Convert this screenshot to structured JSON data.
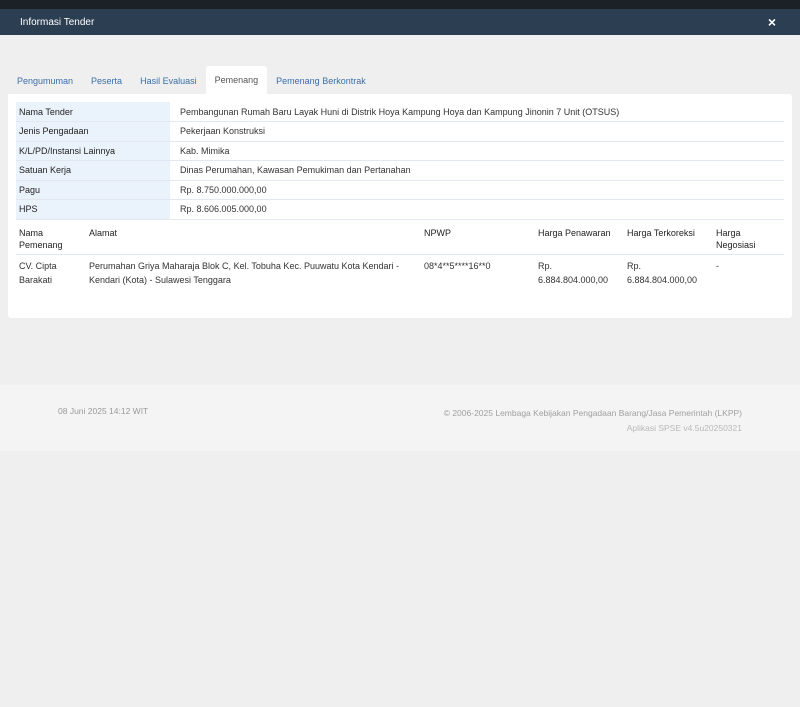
{
  "modal": {
    "title": "Informasi Tender",
    "close_icon": "×"
  },
  "tabs": [
    "Pengumuman",
    "Peserta",
    "Hasil Evaluasi",
    "Pemenang",
    "Pemenang Berkontrak"
  ],
  "active_tab": "Pemenang",
  "info": [
    {
      "label": "Nama Tender",
      "value": "Pembangunan Rumah Baru Layak Huni di Distrik Hoya Kampung Hoya dan Kampung Jinonin 7 Unit (OTSUS)"
    },
    {
      "label": "Jenis Pengadaan",
      "value": "Pekerjaan Konstruksi"
    },
    {
      "label": "K/L/PD/Instansi Lainnya",
      "value": "Kab. Mimika"
    },
    {
      "label": "Satuan Kerja",
      "value": "Dinas Perumahan, Kawasan Pemukiman dan Pertanahan"
    },
    {
      "label": "Pagu",
      "value": "Rp. 8.750.000.000,00"
    },
    {
      "label": "HPS",
      "value": "Rp. 8.606.005.000,00"
    }
  ],
  "winners": {
    "headers": {
      "nama_a": "Nama",
      "nama_b": "Pemenang",
      "alamat": "Alamat",
      "npwp": "NPWP",
      "harga_penawaran": "Harga Penawaran",
      "harga_terkoreksi": "Harga Terkoreksi",
      "negosiasi_a": "Harga",
      "negosiasi_b": "Negosiasi"
    },
    "rows": [
      {
        "nama_a": "CV. Cipta",
        "nama_b": "Barakati",
        "alamat_a": "Perumahan Griya Maharaja Blok C, Kel. Tobuha Kec. Puuwatu Kota Kendari -",
        "alamat_b": "Kendari (Kota) - Sulawesi Tenggara",
        "npwp": "08*4**5****16**0",
        "penawaran_a": "Rp.",
        "penawaran_b": "6.884.804.000,00",
        "terkoreksi_a": "Rp.",
        "terkoreksi_b": "6.884.804.000,00",
        "negosiasi": "-"
      }
    ]
  },
  "footer": {
    "date": "08 Juni 2025 14:12 WIT",
    "copyright": "© 2006-2025 Lembaga Kebijakan Pengadaan Barang/Jasa Pemerintah (LKPP)",
    "version": "Aplikasi SPSE v4.5u20250321"
  }
}
